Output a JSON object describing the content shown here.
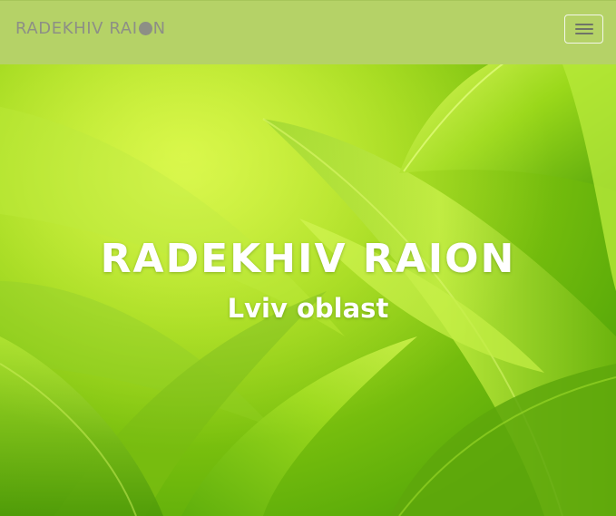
{
  "navbar": {
    "brand_prefix": "RADEKHIV RAI",
    "brand_suffix": "N",
    "menu_icon": "hamburger-menu-icon"
  },
  "hero": {
    "title": "RADEKHIV RAION",
    "subtitle": "Lviv oblast",
    "background": "green-leaves-photo"
  },
  "colors": {
    "navbar_bg": "#b5d267",
    "brand_text": "#8d8f86",
    "hero_text": "#ffffff",
    "leaf_light": "#c8ef2a",
    "leaf_dark": "#3f8d06"
  }
}
